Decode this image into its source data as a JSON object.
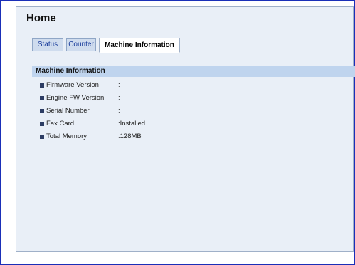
{
  "page": {
    "title": "Home"
  },
  "tabs": [
    {
      "label": "Status"
    },
    {
      "label": "Counter"
    },
    {
      "label": "Machine Information"
    }
  ],
  "section": {
    "title": "Machine Information"
  },
  "machine_info": [
    {
      "label": "Firmware Version",
      "value": ":"
    },
    {
      "label": "Engine FW Version",
      "value": ":"
    },
    {
      "label": "Serial Number",
      "value": ":"
    },
    {
      "label": "Fax Card",
      "value": ":Installed"
    },
    {
      "label": "Total Memory",
      "value": ":128MB"
    }
  ],
  "colors": {
    "frame_border": "#1a2fb8",
    "panel_background": "#e9eff7",
    "section_header": "#bfd4ee",
    "tab_inactive": "#cfdcee",
    "tab_link_text": "#1a3d9c"
  }
}
